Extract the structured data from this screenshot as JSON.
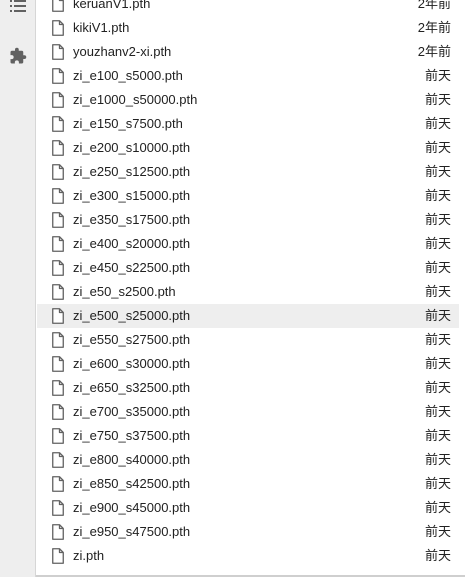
{
  "sidebar": {
    "items": [
      {
        "icon": "list-icon"
      },
      {
        "icon": "puzzle-icon"
      }
    ]
  },
  "files": [
    {
      "name": "keruanV1.pth",
      "modified": "2年前"
    },
    {
      "name": "kikiV1.pth",
      "modified": "2年前"
    },
    {
      "name": "youzhanv2-xi.pth",
      "modified": "2年前"
    },
    {
      "name": "zi_e100_s5000.pth",
      "modified": "前天"
    },
    {
      "name": "zi_e1000_s50000.pth",
      "modified": "前天"
    },
    {
      "name": "zi_e150_s7500.pth",
      "modified": "前天"
    },
    {
      "name": "zi_e200_s10000.pth",
      "modified": "前天"
    },
    {
      "name": "zi_e250_s12500.pth",
      "modified": "前天"
    },
    {
      "name": "zi_e300_s15000.pth",
      "modified": "前天"
    },
    {
      "name": "zi_e350_s17500.pth",
      "modified": "前天"
    },
    {
      "name": "zi_e400_s20000.pth",
      "modified": "前天"
    },
    {
      "name": "zi_e450_s22500.pth",
      "modified": "前天"
    },
    {
      "name": "zi_e50_s2500.pth",
      "modified": "前天"
    },
    {
      "name": "zi_e500_s25000.pth",
      "modified": "前天",
      "selected": true
    },
    {
      "name": "zi_e550_s27500.pth",
      "modified": "前天"
    },
    {
      "name": "zi_e600_s30000.pth",
      "modified": "前天"
    },
    {
      "name": "zi_e650_s32500.pth",
      "modified": "前天"
    },
    {
      "name": "zi_e700_s35000.pth",
      "modified": "前天"
    },
    {
      "name": "zi_e750_s37500.pth",
      "modified": "前天"
    },
    {
      "name": "zi_e800_s40000.pth",
      "modified": "前天"
    },
    {
      "name": "zi_e850_s42500.pth",
      "modified": "前天"
    },
    {
      "name": "zi_e900_s45000.pth",
      "modified": "前天"
    },
    {
      "name": "zi_e950_s47500.pth",
      "modified": "前天"
    },
    {
      "name": "zi.pth",
      "modified": "前天"
    }
  ]
}
